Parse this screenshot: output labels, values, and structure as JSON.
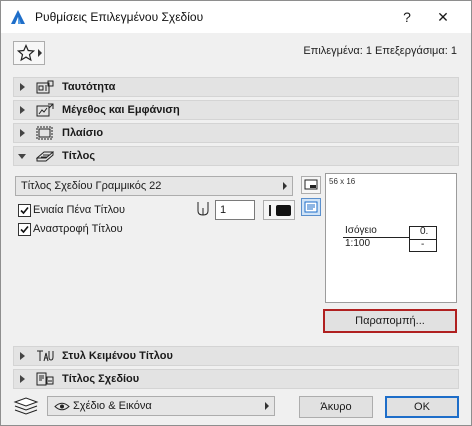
{
  "window": {
    "title": "Ρυθμίσεις Επιλεγμένου Σχεδίου",
    "help": "?",
    "close": "✕"
  },
  "header": {
    "selected_info": "Επιλεγμένα: 1 Επεξεργάσιμα: 1"
  },
  "panels": {
    "identity": "Ταυτότητα",
    "size": "Μέγεθος και Εμφάνιση",
    "frame": "Πλαίσιο",
    "title": "Τίτλος",
    "title_text_style": "Στυλ Κειμένου Τίτλου",
    "drawing_title": "Τίτλος Σχεδίου"
  },
  "title_section": {
    "title_type": "Τίτλος Σχεδίου Γραμμικός 22",
    "uniform_pen": {
      "label": "Ενιαία Πένα Τίτλου",
      "checked": true,
      "value": "1"
    },
    "flip_title": {
      "label": "Αναστροφή Τίτλου",
      "checked": true
    },
    "preview": {
      "size": "56 x 16",
      "name": "Ισόγειο",
      "scale": "1:100",
      "number": "0.",
      "dash": "-"
    },
    "parameters_button": "Παραπομπή..."
  },
  "footer": {
    "view_option": "Σχέδιο & Εικόνα",
    "cancel": "Άκυρο",
    "ok": "OK"
  },
  "colors": {
    "accent_blue": "#1e6ec9",
    "highlight_red": "#b02020",
    "panel_bg": "#e3e3e3"
  }
}
